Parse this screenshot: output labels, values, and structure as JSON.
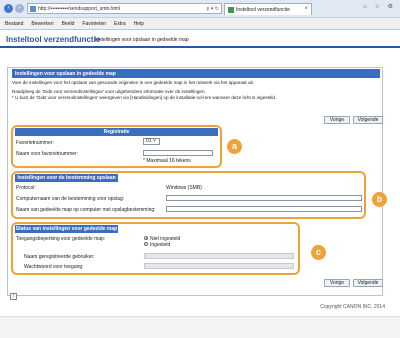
{
  "browser": {
    "url": "http://••••••••••/sendsupport_smb.html",
    "url_tools": "ρ ▾ ↻",
    "tab_label": "Insteltool verzendfunctie",
    "tab_close": "×",
    "window_tools": "⌂ ☆ ⚙",
    "menu": [
      "Bestand",
      "Bewerken",
      "Beeld",
      "Favorieten",
      "Extra",
      "Help"
    ]
  },
  "header": {
    "title": "Insteltool verzendfunctie",
    "subtitle": "Instellingen voor opslaan in gedeelde map"
  },
  "panel": {
    "title": "Instellingen voor opslaan in gedeelde map",
    "intro_1": "Voer de instellingen voor het opslaan van gescande originelen in een gedeelde map in het netwerk via het apparaat uit.",
    "intro_2": "Raadpleeg de 'Gids voor verzendinstellingen' voor uitgebreidere informatie over de instellingen.",
    "intro_3": "* U kunt de 'Gids voor verzendinstellingen' weergeven via [Handleidingen] op de installatie-cd-rom wanneer deze licht is ingesteld."
  },
  "buttons": {
    "previous": "Vorige",
    "next": "Volgende"
  },
  "registration": {
    "heading": "Registratie",
    "favorite_label": "Favorietnummer:",
    "favorite_value": "01",
    "name_label": "Naam voor favorietnummer:",
    "name_value": "",
    "name_hint": "* Maximaal 16 tekens",
    "badge": "a"
  },
  "destination": {
    "heading": "Instellingen voor de bestemming opslaan",
    "protocol_label": "Protocol:",
    "protocol_value": "Windows (SMB)",
    "computer_label": "Computernaam van de bestemming voor opslag:",
    "computer_value": "",
    "share_label": "Naam van gedeelde map op computer met opslagbestemming:",
    "share_value": "",
    "badge": "b"
  },
  "shared_status": {
    "heading": "Status van instellingen voor gedeelde map",
    "access_label": "Toegangsbeperking voor gedeelde map:",
    "option_off": "Niet ingesteld",
    "option_on": "Ingesteld",
    "user_label": "Naam geregistreerde gebruiker:",
    "password_label": "Wachtwoord voor toegang:",
    "badge": "c"
  },
  "footer": {
    "copyright": "Copyright CANON INC. 2014"
  }
}
